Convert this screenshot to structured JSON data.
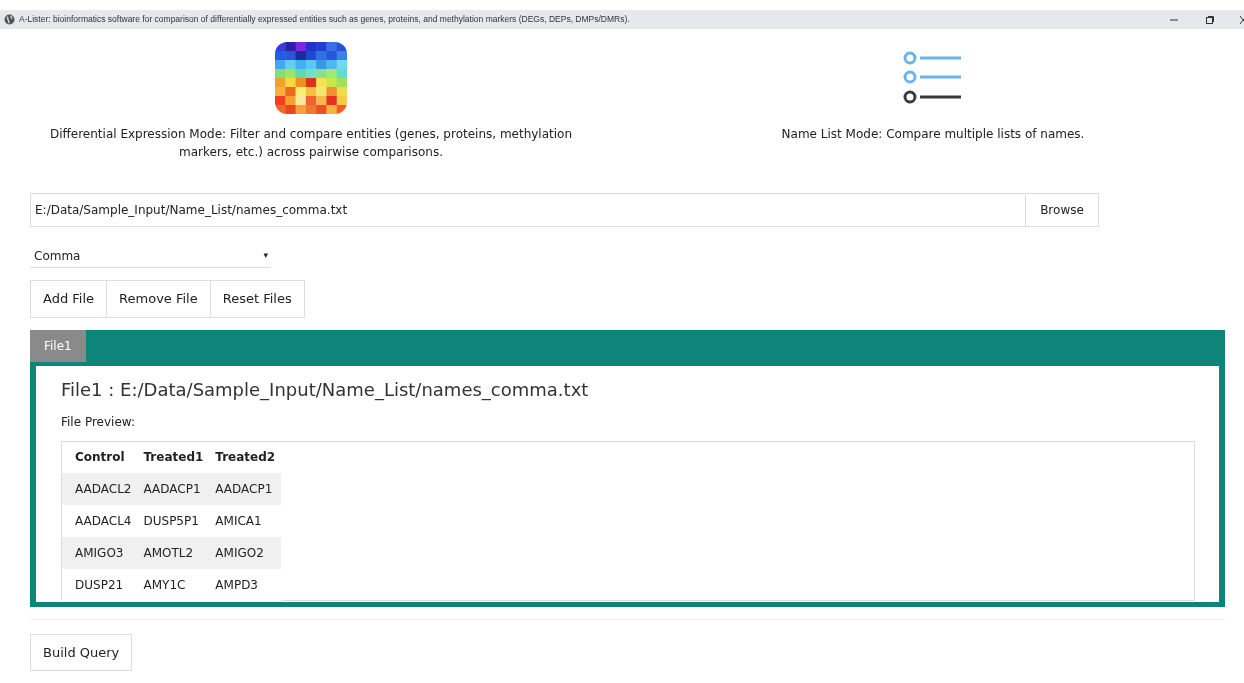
{
  "window": {
    "title": "A-Lister: bioinformatics software for comparison of differentially expressed entities such as genes, proteins, and methylation markers (DEGs, DEPs, DMPs/DMRs)."
  },
  "modes": [
    {
      "kind": "heatmap",
      "description": "Differential Expression Mode: Filter and compare entities (genes, proteins, methylation markers, etc.) across pairwise comparisons."
    },
    {
      "kind": "list",
      "description": "Name List Mode: Compare multiple lists of names."
    }
  ],
  "file_field": {
    "value": "E:/Data/Sample_Input/Name_List/names_comma.txt",
    "button": "Browse"
  },
  "delimiter": {
    "value": "Comma",
    "arrow": "▾"
  },
  "file_buttons": [
    "Add File",
    "Remove File",
    "Reset Files"
  ],
  "tabs": [
    {
      "label": "File1",
      "selected": true
    }
  ],
  "panel": {
    "title": "File1 : E:/Data/Sample_Input/Name_List/names_comma.txt",
    "preview_label": "File Preview:",
    "columns": [
      "Control",
      "Treated1",
      "Treated2"
    ],
    "rows": [
      [
        "AADACL2",
        "AADACP1",
        "AADACP1"
      ],
      [
        "AADACL4",
        "DUSP5P1",
        "AMICA1"
      ],
      [
        "AMIGO3",
        "AMOTL2",
        "AMIGO2"
      ],
      [
        "DUSP21",
        "AMY1C",
        "AMPD3"
      ]
    ]
  },
  "build_button": "Build Query"
}
